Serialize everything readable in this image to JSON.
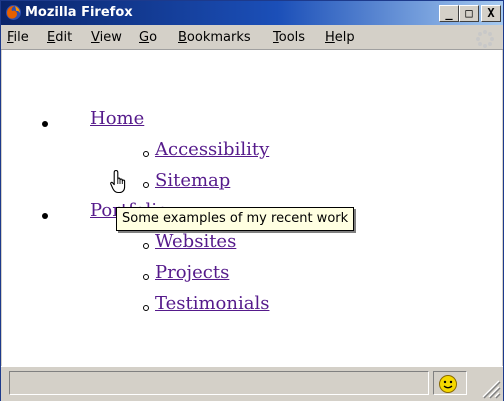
{
  "window": {
    "title": "Mozilla Firefox",
    "buttons": {
      "minimize": "_",
      "maximize": "□",
      "close": "X"
    }
  },
  "menubar": {
    "items": [
      {
        "label": "File",
        "underline": "F"
      },
      {
        "label": "Edit",
        "underline": "E"
      },
      {
        "label": "View",
        "underline": "V"
      },
      {
        "label": "Go",
        "underline": "G"
      },
      {
        "label": "Bookmarks",
        "underline": "B"
      },
      {
        "label": "Tools",
        "underline": "T"
      },
      {
        "label": "Help",
        "underline": "H"
      }
    ]
  },
  "nav": {
    "home": "Home",
    "home_children": [
      "Accessibility",
      "Sitemap"
    ],
    "portfolio": "Portfolio",
    "portfolio_children": [
      "Websites",
      "Projects",
      "Testimonials"
    ]
  },
  "tooltip": {
    "text": "Some examples of my recent work"
  },
  "colors": {
    "link": "#551a8b",
    "titlebar_start": "#0a246a",
    "titlebar_end": "#a6caf0",
    "tooltip_bg": "#ffffe1"
  },
  "icons": {
    "title": "firefox-logo-icon",
    "throbber": "throbber-icon",
    "status": "smiley-icon",
    "cursor": "hand-pointer-icon"
  }
}
